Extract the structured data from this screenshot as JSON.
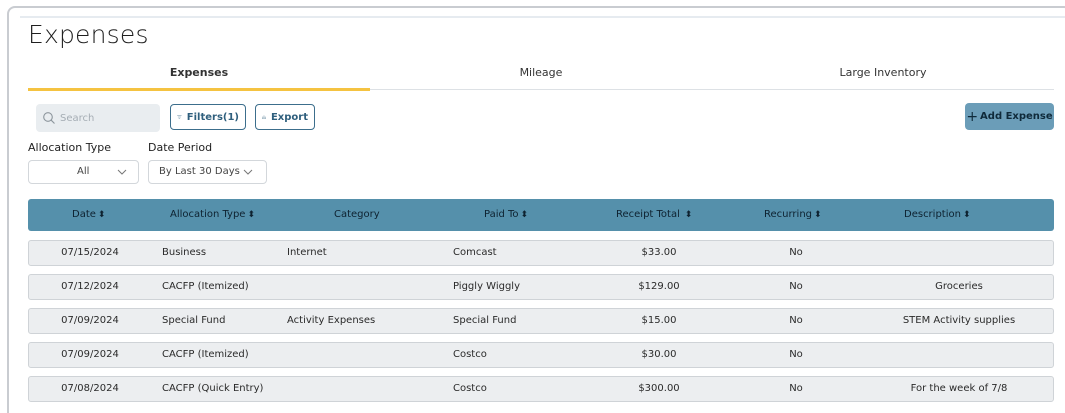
{
  "page": {
    "title": "Expenses"
  },
  "tabs": [
    {
      "label": "Expenses",
      "active": true
    },
    {
      "label": "Mileage",
      "active": false
    },
    {
      "label": "Large Inventory",
      "active": false
    }
  ],
  "toolbar": {
    "search_placeholder": "Search",
    "filters_label": "Filters(1)",
    "export_label": "Export",
    "add_label": "Add Expense",
    "add_icon": "plus"
  },
  "filters": {
    "allocation_type": {
      "label": "Allocation Type",
      "value": "All"
    },
    "date_period": {
      "label": "Date Period",
      "value": "By Last 30 Days"
    }
  },
  "table": {
    "columns": [
      {
        "label": "Date",
        "sortable": true
      },
      {
        "label": "Allocation Type",
        "sortable": true
      },
      {
        "label": "Category",
        "sortable": false
      },
      {
        "label": "Paid To",
        "sortable": true
      },
      {
        "label": "Receipt Total",
        "sortable": true
      },
      {
        "label": "Recurring",
        "sortable": true
      },
      {
        "label": "Description",
        "sortable": true
      }
    ],
    "rows": [
      {
        "date": "07/15/2024",
        "allocation": "Business",
        "category": "Internet",
        "paid_to": "Comcast",
        "total": "$33.00",
        "recurring": "No",
        "description": ""
      },
      {
        "date": "07/12/2024",
        "allocation": "CACFP (Itemized)",
        "category": "",
        "paid_to": "Piggly Wiggly",
        "total": "$129.00",
        "recurring": "No",
        "description": "Groceries"
      },
      {
        "date": "07/09/2024",
        "allocation": "Special Fund",
        "category": "Activity Expenses",
        "paid_to": "Special Fund",
        "total": "$15.00",
        "recurring": "No",
        "description": "STEM Activity supplies"
      },
      {
        "date": "07/09/2024",
        "allocation": "CACFP (Itemized)",
        "category": "",
        "paid_to": "Costco",
        "total": "$30.00",
        "recurring": "No",
        "description": ""
      },
      {
        "date": "07/08/2024",
        "allocation": "CACFP (Quick Entry)",
        "category": "",
        "paid_to": "Costco",
        "total": "$300.00",
        "recurring": "No",
        "description": "For the week of 7/8"
      }
    ]
  },
  "colors": {
    "accent_tab": "#f5c341",
    "table_header": "#5590ab",
    "add_button": "#6b9db8",
    "outline_button": "#3c6e8c"
  }
}
